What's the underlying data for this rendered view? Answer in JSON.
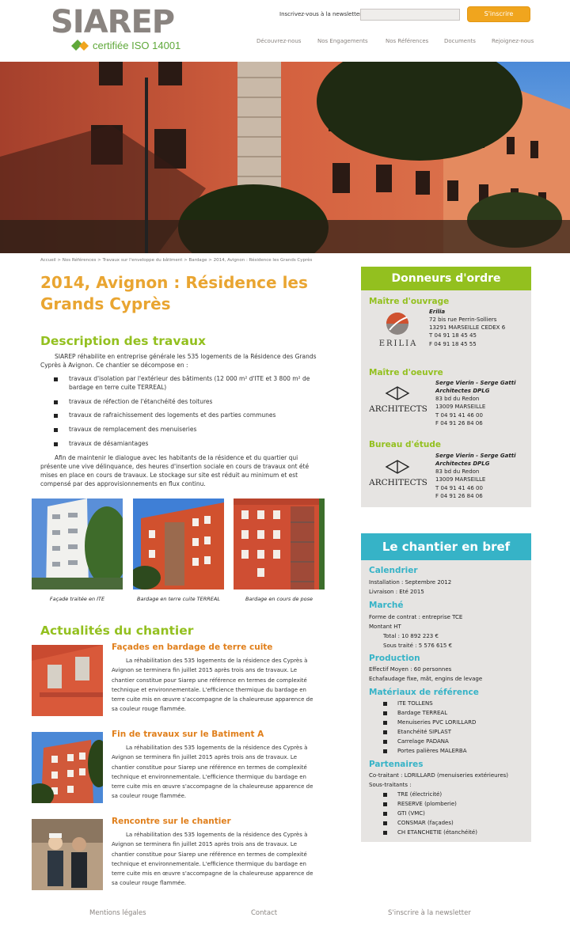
{
  "header": {
    "logo_text": "SIAREP",
    "logo_tagline": "certifiée ISO 14001",
    "newsletter_label": "Inscrivez-vous à la newsletter",
    "newsletter_placeholder": "",
    "newsletter_button": "S'inscrire",
    "nav": [
      "Découvrez-nous",
      "Nos Engagements",
      "Nos Références",
      "Documents",
      "Rejoignez-nous"
    ]
  },
  "breadcrumb": [
    "Accueil",
    "Nos Références",
    "Travaux sur l'enveloppe du bâtiment",
    "Bardage",
    "2014, Avignon : Résidence les Grands Cyprès"
  ],
  "breadcrumb_sep": " > ",
  "main": {
    "title": "2014, Avignon : Résidence les Grands Cyprès",
    "description_heading": "Description des travaux",
    "intro": "SIAREP réhabilite en entreprise générale les 535 logements de la Résidence des Grands Cyprès à Avignon. Ce chantier se décompose en :",
    "works": [
      "travaux d'isolation par l'extérieur des bâtiments (12 000 m² d'ITE et 3 800 m² de bardage en terre cuite TERREAL)",
      "travaux de réfection de l'étanchéité des toitures",
      "travaux de rafraichissement des logements et des parties communes",
      "travaux de remplacement des menuiseries",
      "travaux de désamiantages"
    ],
    "outro": "Afin de maintenir le dialogue avec les habitants de la résidence et du quartier qui présente une vive délinquance, des heures d'insertion sociale en cours de travaux ont été mises en place en cours de travaux. Le stockage sur site est réduit au minimum et est compensé par des approvisionnements en flux continu.",
    "photo_captions": [
      "Façade traitée en ITE",
      "Bardage en terre cuite TERREAL",
      "Bardage en cours de pose"
    ],
    "news_heading": "Actualités du chantier",
    "news": [
      {
        "title": "Façades en bardage de terre cuite",
        "text": "La réhabilitation des 535 logements de la résidence des Cyprès à Avignon se terminera fin juillet 2015 après trois ans de travaux. Le chantier constitue pour Siarep une référence en termes de complexité technique et environnementale.  L'efficience thermique du bardage en terre cuite mis en œuvre s'accompagne de la chaleureuse apparence de sa couleur rouge flammée."
      },
      {
        "title": "Fin de travaux sur le Batiment A",
        "text": "La réhabilitation des 535 logements de la résidence des Cyprès à Avignon se terminera fin juillet 2015 après trois ans de travaux. Le chantier constitue pour Siarep une référence en termes de complexité technique et environnementale.  L'efficience thermique du bardage en terre cuite mis en œuvre s'accompagne de la chaleureuse apparence de sa couleur rouge flammée."
      },
      {
        "title": "Rencontre sur le chantier",
        "text": "La réhabilitation des 535 logements de la résidence des Cyprès à Avignon se terminera fin juillet 2015 après trois ans de travaux. Le chantier constitue pour Siarep une référence en termes de complexité technique et environnementale.  L'efficience thermique du bardage en terre cuite mis en œuvre s'accompagne de la chaleureuse apparence de sa couleur rouge flammée."
      }
    ]
  },
  "donneurs": {
    "heading": "Donneurs d'ordre",
    "sections": [
      {
        "title": "Maître d'ouvrage",
        "logo_text": "ERILIA",
        "lines": [
          "Erilia",
          "72 bis rue Perrin-Solliers",
          "13291 MARSEILLE CEDEX 6",
          "T 04 91 18 45 45",
          "F 04 91 18 45 55"
        ]
      },
      {
        "title": "Maître d'oeuvre",
        "logo_text": "ARCHITECTS",
        "lines": [
          "Serge Vierin - Serge Gatti",
          "Architectes DPLG",
          "83 bd du Redon",
          "13009 MARSEILLE",
          "T 04 91 41 46 00",
          "F 04 91 26 84 06"
        ]
      },
      {
        "title": "Bureau d'étude",
        "logo_text": "ARCHITECTS",
        "lines": [
          "Serge Vierin - Serge Gatti",
          "Architectes DPLG",
          "83 bd du Redon",
          "13009 MARSEILLE",
          "T 04 91 41 46 00",
          "F 04 91 26 84 06"
        ]
      }
    ]
  },
  "brief": {
    "heading": "Le chantier en bref",
    "calendar_title": "Calendrier",
    "calendar": [
      "Installation : Septembre 2012",
      "Livraison : Eté 2015"
    ],
    "market_title": "Marché",
    "market": [
      "Forme de contrat : entreprise TCE",
      "Montant HT",
      "Total : 10 892 223 €",
      "Sous traité : 5 576 615 €"
    ],
    "production_title": "Production",
    "production": [
      "Effectif Moyen : 60 personnes",
      "Echafaudage fixe, mât, engins de levage"
    ],
    "materials_title": "Matériaux de référence",
    "materials": [
      "ITE TOLLENS",
      "Bardage TERREAL",
      "Menuiseries PVC LORILLARD",
      "Etanchéité SIPLAST",
      "Carrelage PADANA",
      "Portes palières MALERBA"
    ],
    "partners_title": "Partenaires",
    "partners": [
      "Co-traitant : LORILLARD (menuiseries extérieures)",
      "Sous-traitants :"
    ],
    "subcontractors": [
      "TRE (électricité)",
      "RESERVE (plomberie)",
      "GTI (VMC)",
      "CONSMAR (façades)",
      "CH ETANCHETIE (étanchéité)"
    ]
  },
  "footer": [
    "Mentions légales",
    "Contact",
    "S'inscrire à la newsletter"
  ],
  "colors": {
    "orange": "#e9a531",
    "green": "#93c01f",
    "cyan": "#36b3c7",
    "grey_box": "#e6e4e2"
  }
}
